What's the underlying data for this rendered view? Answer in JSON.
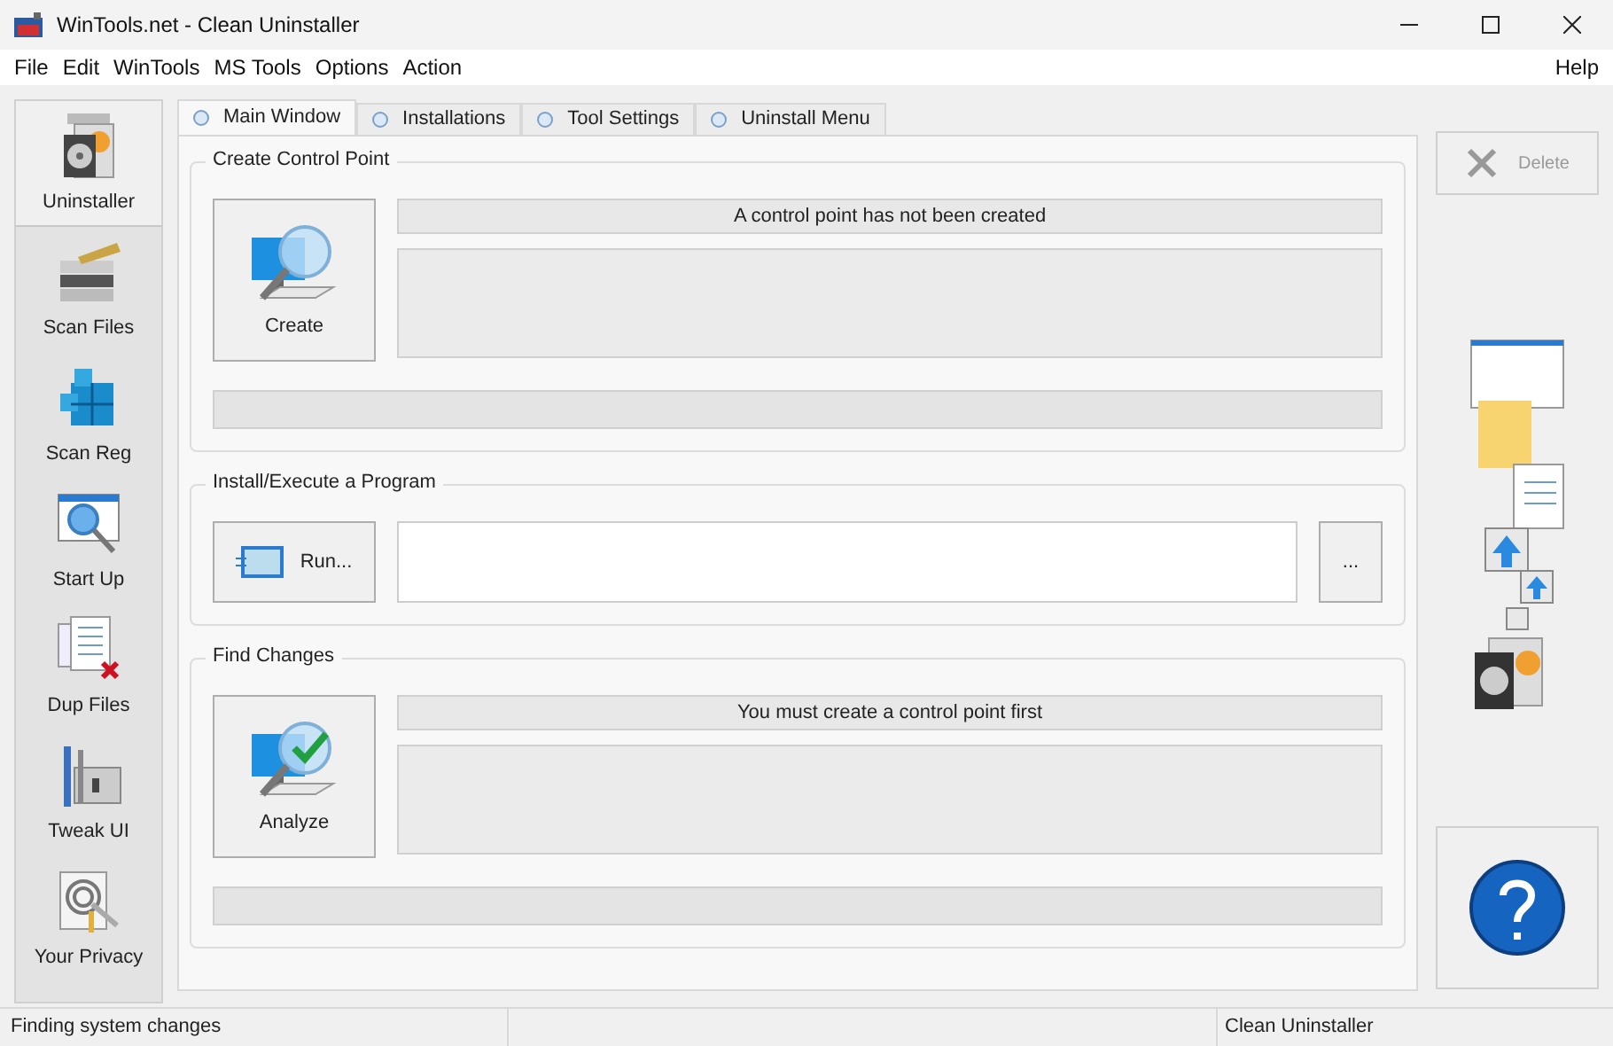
{
  "window": {
    "title": "WinTools.net - Clean Uninstaller"
  },
  "menu": [
    "File",
    "Edit",
    "WinTools",
    "MS Tools",
    "Options",
    "Action"
  ],
  "help_menu": "Help",
  "sidebar": [
    {
      "label": "Uninstaller",
      "kind": "uninstaller",
      "selected": true
    },
    {
      "label": "Scan Files",
      "kind": "files",
      "selected": false
    },
    {
      "label": "Scan Reg",
      "kind": "reg",
      "selected": false
    },
    {
      "label": "Start Up",
      "kind": "startup",
      "selected": false
    },
    {
      "label": "Dup Files",
      "kind": "dup",
      "selected": false
    },
    {
      "label": "Tweak UI",
      "kind": "tweak",
      "selected": false
    },
    {
      "label": "Your Privacy",
      "kind": "privacy",
      "selected": false
    }
  ],
  "tabs": [
    {
      "label": "Main Window",
      "selected": true
    },
    {
      "label": "Installations",
      "selected": false
    },
    {
      "label": "Tool Settings",
      "selected": false
    },
    {
      "label": "Uninstall Menu",
      "selected": false
    }
  ],
  "create_section": {
    "title": "Create Control Point",
    "button": "Create",
    "status": "A control point has not been created",
    "progress": {
      "level": 0
    }
  },
  "install_section": {
    "title": "Install/Execute a Program",
    "button": "Run...",
    "browse": "..."
  },
  "find_section": {
    "title": "Find Changes",
    "button": "Analyze",
    "status": "You must create a control point first",
    "progress": {
      "level": 0
    }
  },
  "delete_button": {
    "label": "Delete",
    "disabled": true
  },
  "status_bar": {
    "left": "Finding system changes",
    "right": "Clean Uninstaller"
  }
}
